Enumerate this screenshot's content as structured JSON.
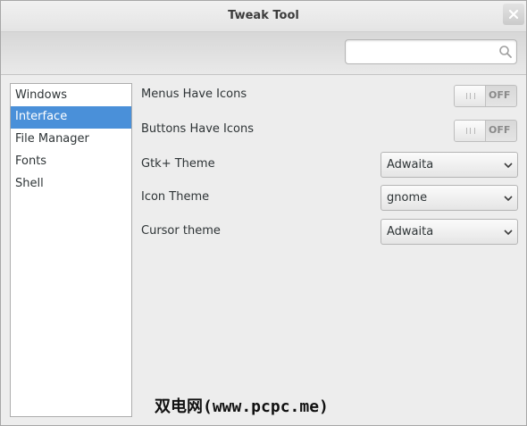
{
  "window": {
    "title": "Tweak Tool"
  },
  "search": {
    "value": "",
    "placeholder": ""
  },
  "sidebar": {
    "items": [
      {
        "label": "Windows",
        "selected": false
      },
      {
        "label": "Interface",
        "selected": true
      },
      {
        "label": "File Manager",
        "selected": false
      },
      {
        "label": "Fonts",
        "selected": false
      },
      {
        "label": "Shell",
        "selected": false
      }
    ]
  },
  "settings": {
    "menus_have_icons": {
      "label": "Menus Have Icons",
      "state": "OFF"
    },
    "buttons_have_icons": {
      "label": "Buttons Have Icons",
      "state": "OFF"
    },
    "gtk_theme": {
      "label": "Gtk+ Theme",
      "value": "Adwaita"
    },
    "icon_theme": {
      "label": "Icon Theme",
      "value": "gnome"
    },
    "cursor_theme": {
      "label": "Cursor theme",
      "value": "Adwaita"
    }
  },
  "watermark": {
    "text": "双电网(www.pcpc.me)"
  },
  "colors": {
    "selection": "#4a90d9",
    "window_bg": "#ededed"
  },
  "icons": {
    "close": "close-icon",
    "search": "search-icon",
    "dropdown": "chevron-down-icon"
  }
}
